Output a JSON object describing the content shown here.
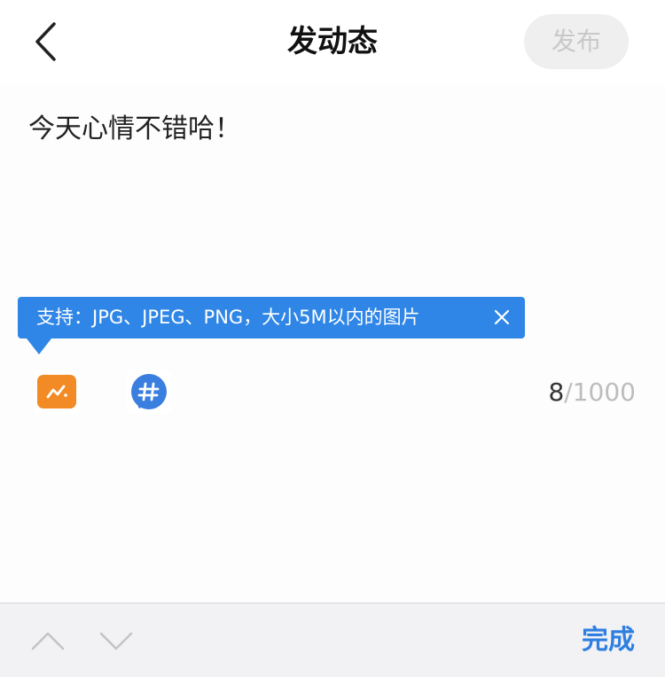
{
  "header": {
    "title": "发动态",
    "publish_label": "发布"
  },
  "editor": {
    "text": "今天心情不错哈！"
  },
  "tooltip": {
    "text": "支持：JPG、JPEG、PNG，大小5M以内的图片"
  },
  "counter": {
    "current": "8",
    "max": "/1000"
  },
  "keyboard_toolbar": {
    "done_label": "完成"
  },
  "colors": {
    "accent": "#2f86e6",
    "image_icon": "#f28a25",
    "publish_disabled_bg": "#efefef",
    "publish_disabled_text": "#c8c8c8"
  },
  "icons": {
    "back": "chevron-left-icon",
    "close": "close-icon",
    "image": "image-icon",
    "topic": "hashtag-icon",
    "up": "chevron-up-icon",
    "down": "chevron-down-icon"
  }
}
